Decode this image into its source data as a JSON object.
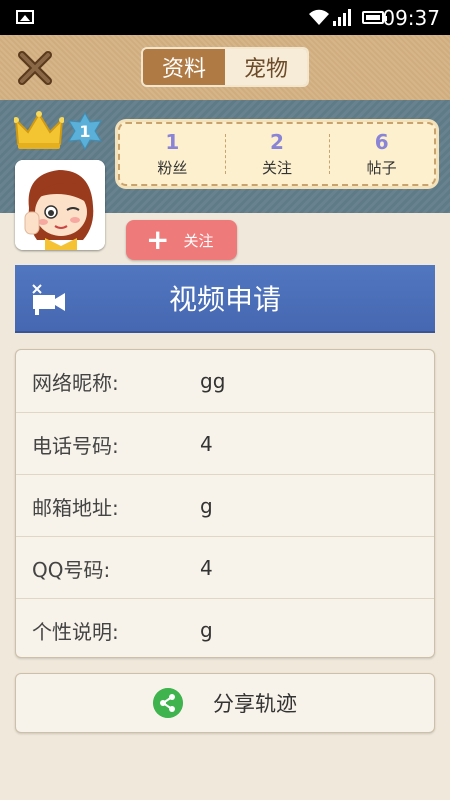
{
  "status_bar": {
    "time": "09:37"
  },
  "header": {
    "tabs": [
      {
        "label": "资料",
        "active": true
      },
      {
        "label": "宠物",
        "active": false
      }
    ]
  },
  "profile": {
    "level": "1",
    "stats": [
      {
        "value": "1",
        "label": "粉丝"
      },
      {
        "value": "2",
        "label": "关注"
      },
      {
        "value": "6",
        "label": "帖子"
      }
    ],
    "follow_label": "关注"
  },
  "video": {
    "title": "视频申请"
  },
  "info": [
    {
      "key": "网络昵称:",
      "value": "gg"
    },
    {
      "key": "电话号码:",
      "value": "4"
    },
    {
      "key": "邮箱地址:",
      "value": "g"
    },
    {
      "key": "QQ号码:",
      "value": "4"
    },
    {
      "key": "个性说明:",
      "value": "g"
    }
  ],
  "share": {
    "label": "分享轨迹"
  },
  "colors": {
    "accent_blue": "#4a6db8",
    "follow_red": "#ef7a7a",
    "tab_active": "#b07a44",
    "stat_number": "#8a84d6",
    "share_green": "#3fb44e"
  }
}
